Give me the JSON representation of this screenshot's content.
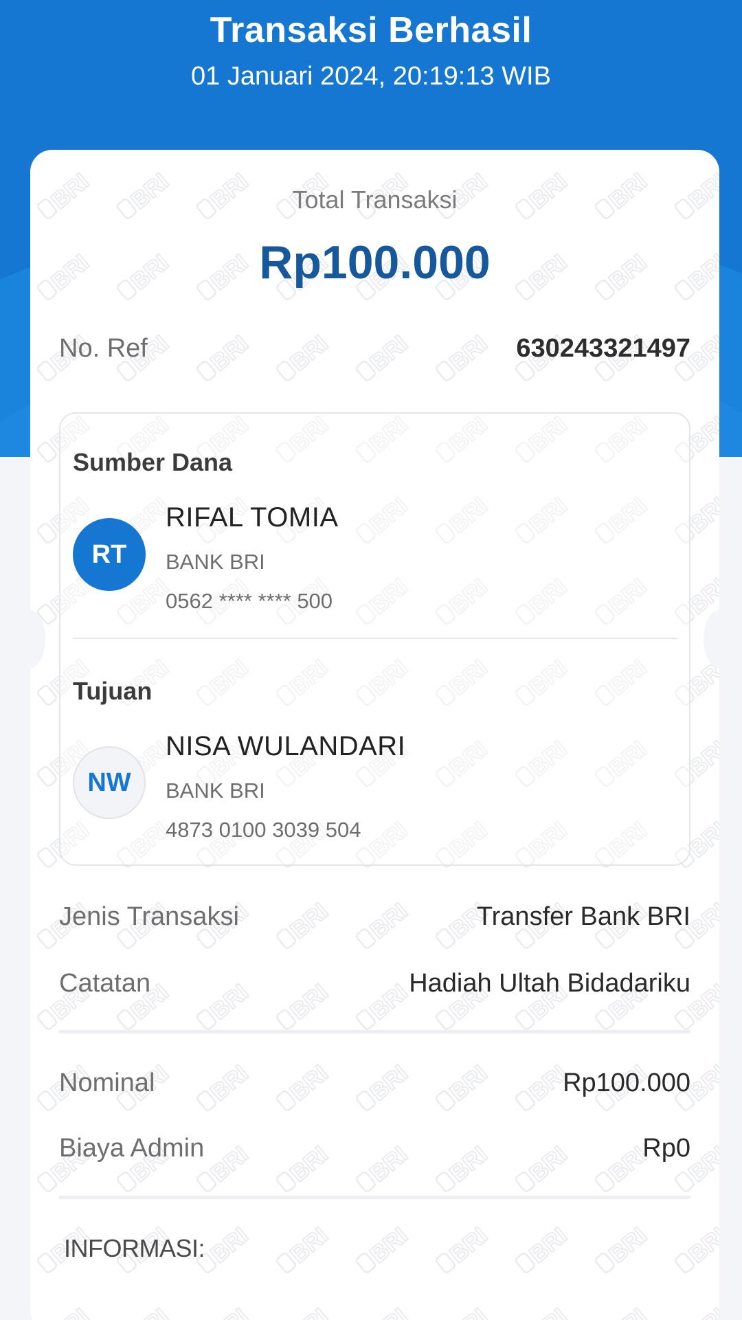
{
  "header": {
    "title": "Transaksi Berhasil",
    "datetime": "01 Januari 2024, 20:19:13 WIB"
  },
  "summary": {
    "total_label": "Total Transaksi",
    "total_value": "Rp100.000"
  },
  "reference": {
    "label": "No. Ref",
    "value": "630243321497"
  },
  "source": {
    "section_title": "Sumber Dana",
    "initials": "RT",
    "name": "RIFAL TOMIA",
    "bank": "BANK BRI",
    "account": "0562 **** **** 500"
  },
  "destination": {
    "section_title": "Tujuan",
    "initials": "NW",
    "name": "NISA WULANDARI",
    "bank": "BANK BRI",
    "account": "4873 0100 3039 504"
  },
  "details": {
    "type_label": "Jenis Transaksi",
    "type_value": "Transfer Bank BRI",
    "note_label": "Catatan",
    "note_value": "Hadiah Ultah Bidadariku",
    "nominal_label": "Nominal",
    "nominal_value": "Rp100.000",
    "fee_label": "Biaya Admin",
    "fee_value": "Rp0"
  },
  "info": {
    "label": "INFORMASI:"
  },
  "watermark": {
    "text": "BRI"
  },
  "colors": {
    "header_blue": "#1677d2",
    "amount_blue": "#15589c"
  }
}
